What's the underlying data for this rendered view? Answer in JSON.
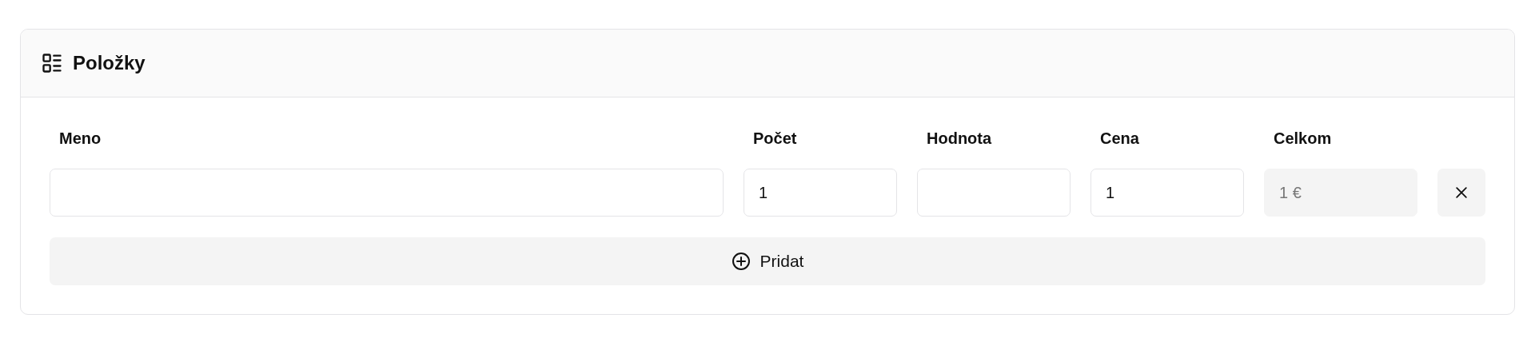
{
  "card": {
    "title": "Položky"
  },
  "columns": [
    "Meno",
    "Počet",
    "Hodnota",
    "Cena",
    "Celkom"
  ],
  "rows": [
    {
      "fields": [
        {
          "disabled": false
        },
        {
          "value": "1",
          "disabled": false
        },
        {
          "disabled": false
        },
        {
          "value": "1",
          "disabled": false
        },
        {
          "value": "1 €",
          "disabled": true
        }
      ]
    }
  ],
  "add_button": {
    "label": "Pridat"
  }
}
